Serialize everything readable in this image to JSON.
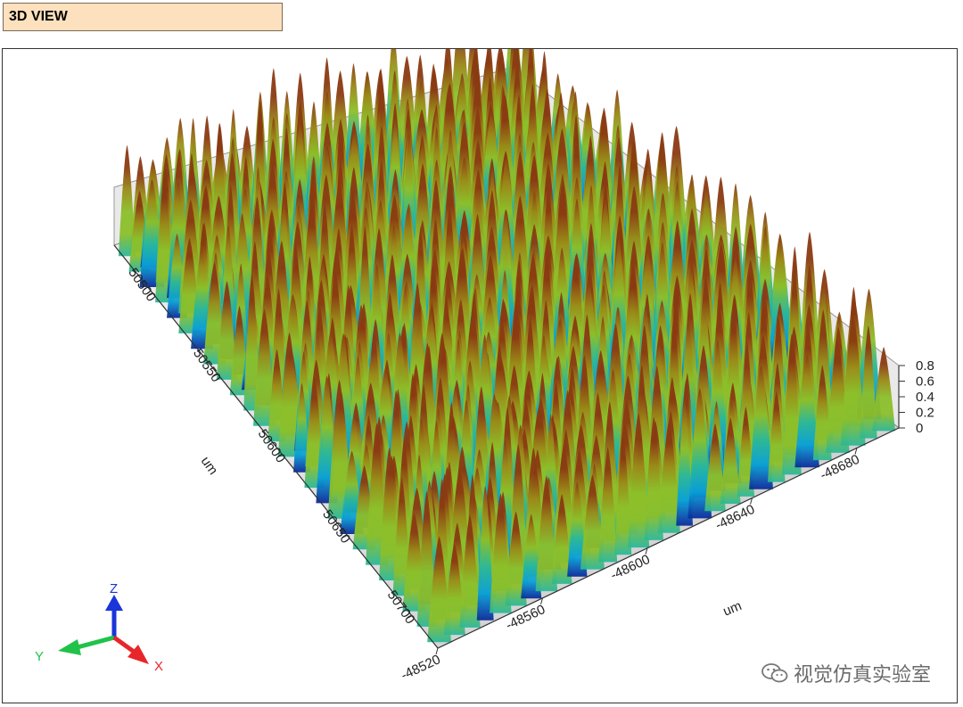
{
  "header": {
    "title": "3D VIEW"
  },
  "chart_data": {
    "type": "surface",
    "title": "",
    "x_axis": {
      "label": "um",
      "ticks": [
        "-48520",
        "-48560",
        "-48600",
        "-48640",
        "-48680"
      ]
    },
    "y_axis": {
      "label": "um",
      "ticks": [
        "50500",
        "50550",
        "50600",
        "50650",
        "50700"
      ]
    },
    "z_axis": {
      "label": "",
      "ticks": [
        "0",
        "0.2",
        "0.4",
        "0.6",
        "0.8"
      ],
      "range": [
        0,
        0.8
      ]
    },
    "colormap": [
      "#0a2a9a",
      "#0aa0d8",
      "#2ab89a",
      "#8cbf2a",
      "#9a8a18",
      "#8a3a12"
    ],
    "floor_color": "#bdbdbd"
  },
  "triad": {
    "x": "X",
    "y": "Y",
    "z": "Z",
    "x_color": "#e8262a",
    "y_color": "#22c24a",
    "z_color": "#1a35d8"
  },
  "watermark": {
    "text": "视觉仿真实验室",
    "icon": "wechat-icon"
  }
}
